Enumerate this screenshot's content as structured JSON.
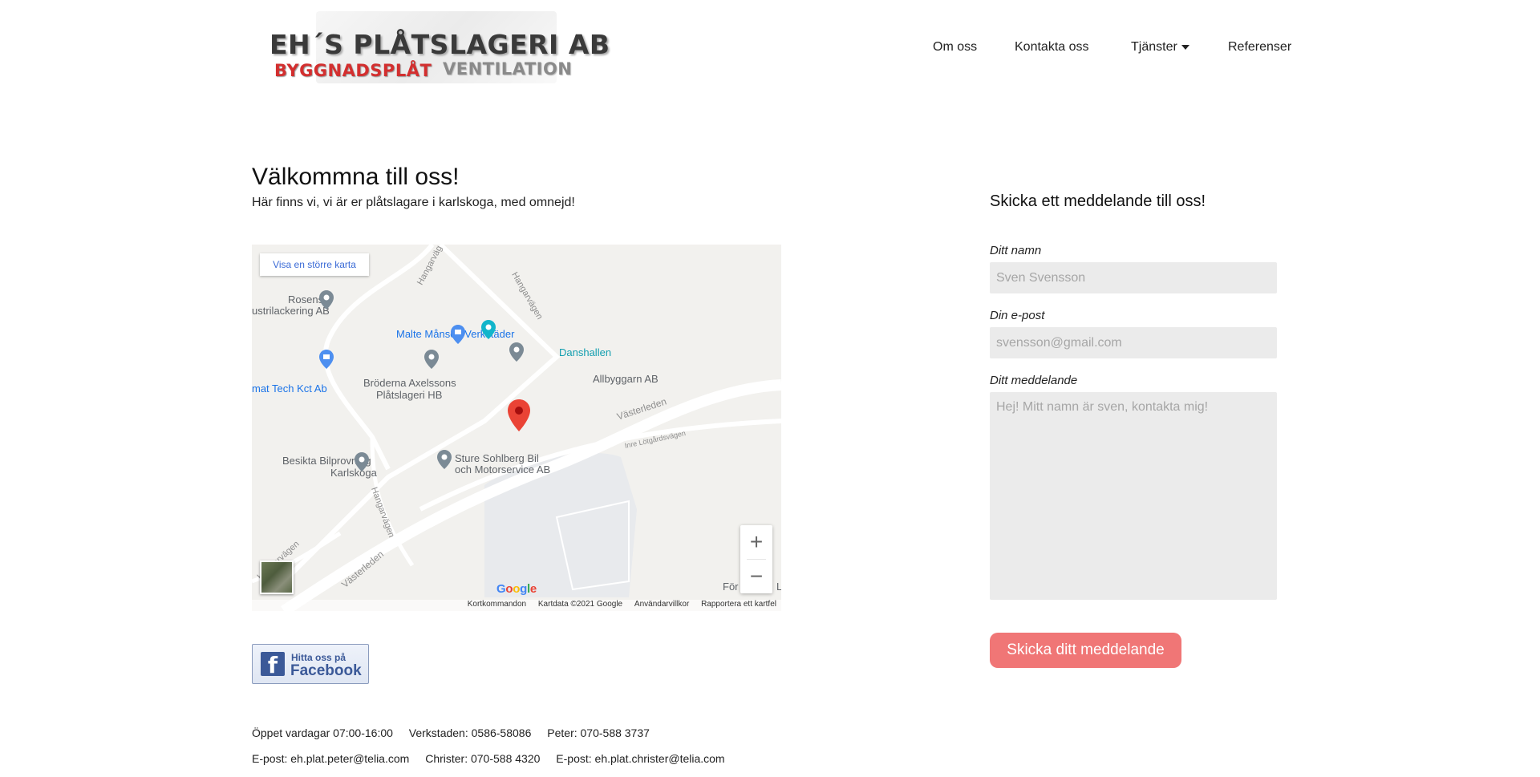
{
  "header": {
    "logo_line1": "EH´S PLÅTSLAGERI AB",
    "logo_line2a": "BYGGNADSPLÅT",
    "logo_line2b": "VENTILATION",
    "nav": {
      "about": "Om oss",
      "contact": "Kontakta oss",
      "services": "Tjänster",
      "references": "Referenser"
    }
  },
  "welcome": {
    "title": "Välkommna till oss!",
    "subtitle": "Här finns vi, vi är er plåtslagare i karlskoga, med omnejd!"
  },
  "map": {
    "larger_map_button": "Visa en större karta",
    "places": {
      "rosensjo_1": "Rosensjö",
      "rosensjo_2": "ustrilackering AB",
      "malte": "Malte Månson Verkstäder",
      "danshallen": "Danshallen",
      "allbyggarn": "Allbyggarn AB",
      "tech": "mat Tech Kct Ab",
      "axelssons_1": "Bröderna Axelssons",
      "axelssons_2": "Plåtslageri HB",
      "besikta_1": "Besikta Bilprovning",
      "besikta_2": "Karlskoga",
      "sture_1": "Sture Sohlberg Bil",
      "sture_2": "och Motorservice AB",
      "for_label": "För",
      "l_label": "L"
    },
    "roads": {
      "hangarvagen_a": "Hangarväg",
      "hangarvagen_b": "Hangarvägen",
      "hangarvagen_c": "Hangarvägen",
      "hangarvagen_d": "Hangarvägen",
      "vasterleden_a": "Västerleden",
      "vasterleden_b": "Västerleden",
      "inre": "Inre Lötgårdsvägen"
    },
    "google": "Google",
    "footer": {
      "shortcuts": "Kortkommandon",
      "mapdata": "Kartdata ©2021 Google",
      "terms": "Användarvillkor",
      "report": "Rapportera ett kartfel"
    }
  },
  "facebook": {
    "line1": "Hitta oss på",
    "line2": "Facebook"
  },
  "info": {
    "hours": "Öppet vardagar 07:00-16:00",
    "workshop": "Verkstaden: 0586-58086",
    "peter": "Peter: 070-588 3737",
    "email_peter": "E-post: eh.plat.peter@telia.com",
    "christer": "Christer: 070-588 4320",
    "email_christer": "E-post: eh.plat.christer@telia.com"
  },
  "form": {
    "title": "Skicka ett meddelande till oss!",
    "name_label": "Ditt namn",
    "name_placeholder": "Sven Svensson",
    "email_label": "Din e-post",
    "email_placeholder": "svensson@gmail.com",
    "message_label": "Ditt meddelande",
    "message_placeholder": "Hej! Mitt namn är sven, kontakta mig!",
    "submit": "Skicka ditt meddelande"
  }
}
